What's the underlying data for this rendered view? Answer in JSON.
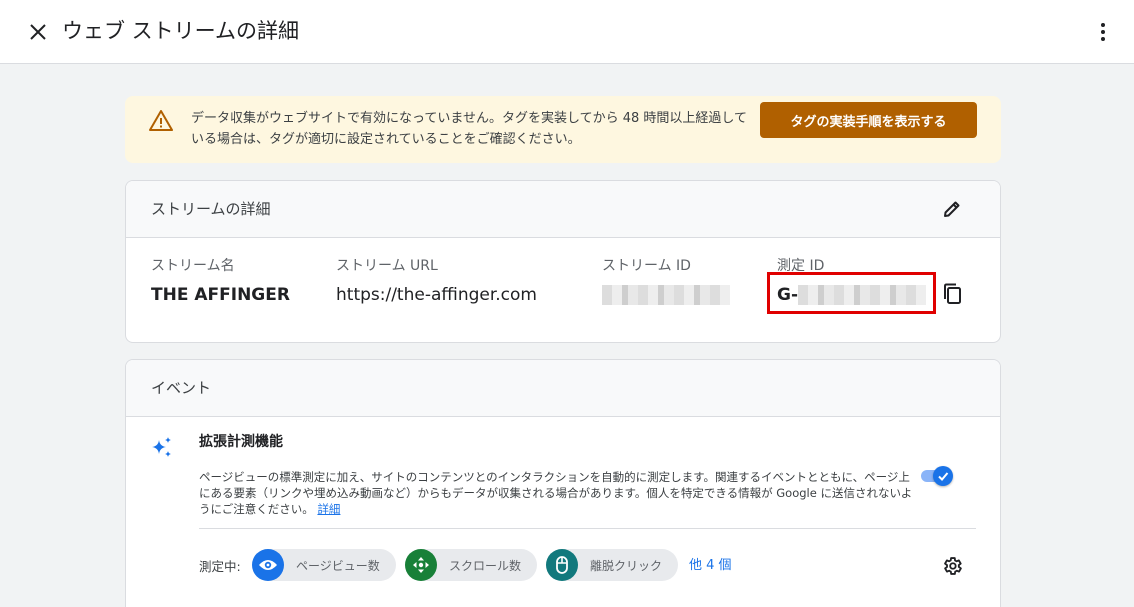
{
  "header": {
    "title": "ウェブ ストリームの詳細"
  },
  "alert": {
    "message": "データ収集がウェブサイトで有効になっていません。タグを実装してから 48 時間以上経過している場合は、タグが適切に設定されていることをご確認ください。",
    "button_label": "タグの実装手順を表示する",
    "color": "#b06000"
  },
  "stream_details": {
    "title": "ストリームの詳細",
    "fields": [
      {
        "label": "ストリーム名",
        "value": "THE AFFINGER"
      },
      {
        "label": "ストリーム URL",
        "value": "https://the-affinger.com"
      },
      {
        "label": "ストリーム ID",
        "value": ""
      },
      {
        "label": "測定 ID",
        "value": "G-"
      }
    ]
  },
  "events": {
    "title": "イベント",
    "enhanced_measurement": {
      "title": "拡張計測機能",
      "description": "ページビューの標準測定に加え、サイトのコンテンツとのインタラクションを自動的に測定します。関連するイベントとともに、ページ上にある要素（リンクや埋め込み動画など）からもデータが収集される場合があります。個人を特定できる情報が Google に送信されないようにご注意ください。",
      "details_link": "詳細",
      "enabled": true,
      "measuring_label": "測定中:",
      "chips": [
        {
          "label": "ページビュー数",
          "icon": "eye-icon",
          "color": "#1a73e8"
        },
        {
          "label": "スクロール数",
          "icon": "move-icon",
          "color": "#188038"
        },
        {
          "label": "離脱クリック",
          "icon": "mouse-icon",
          "color": "#12797d"
        }
      ],
      "more_label": "他 4 個"
    }
  }
}
